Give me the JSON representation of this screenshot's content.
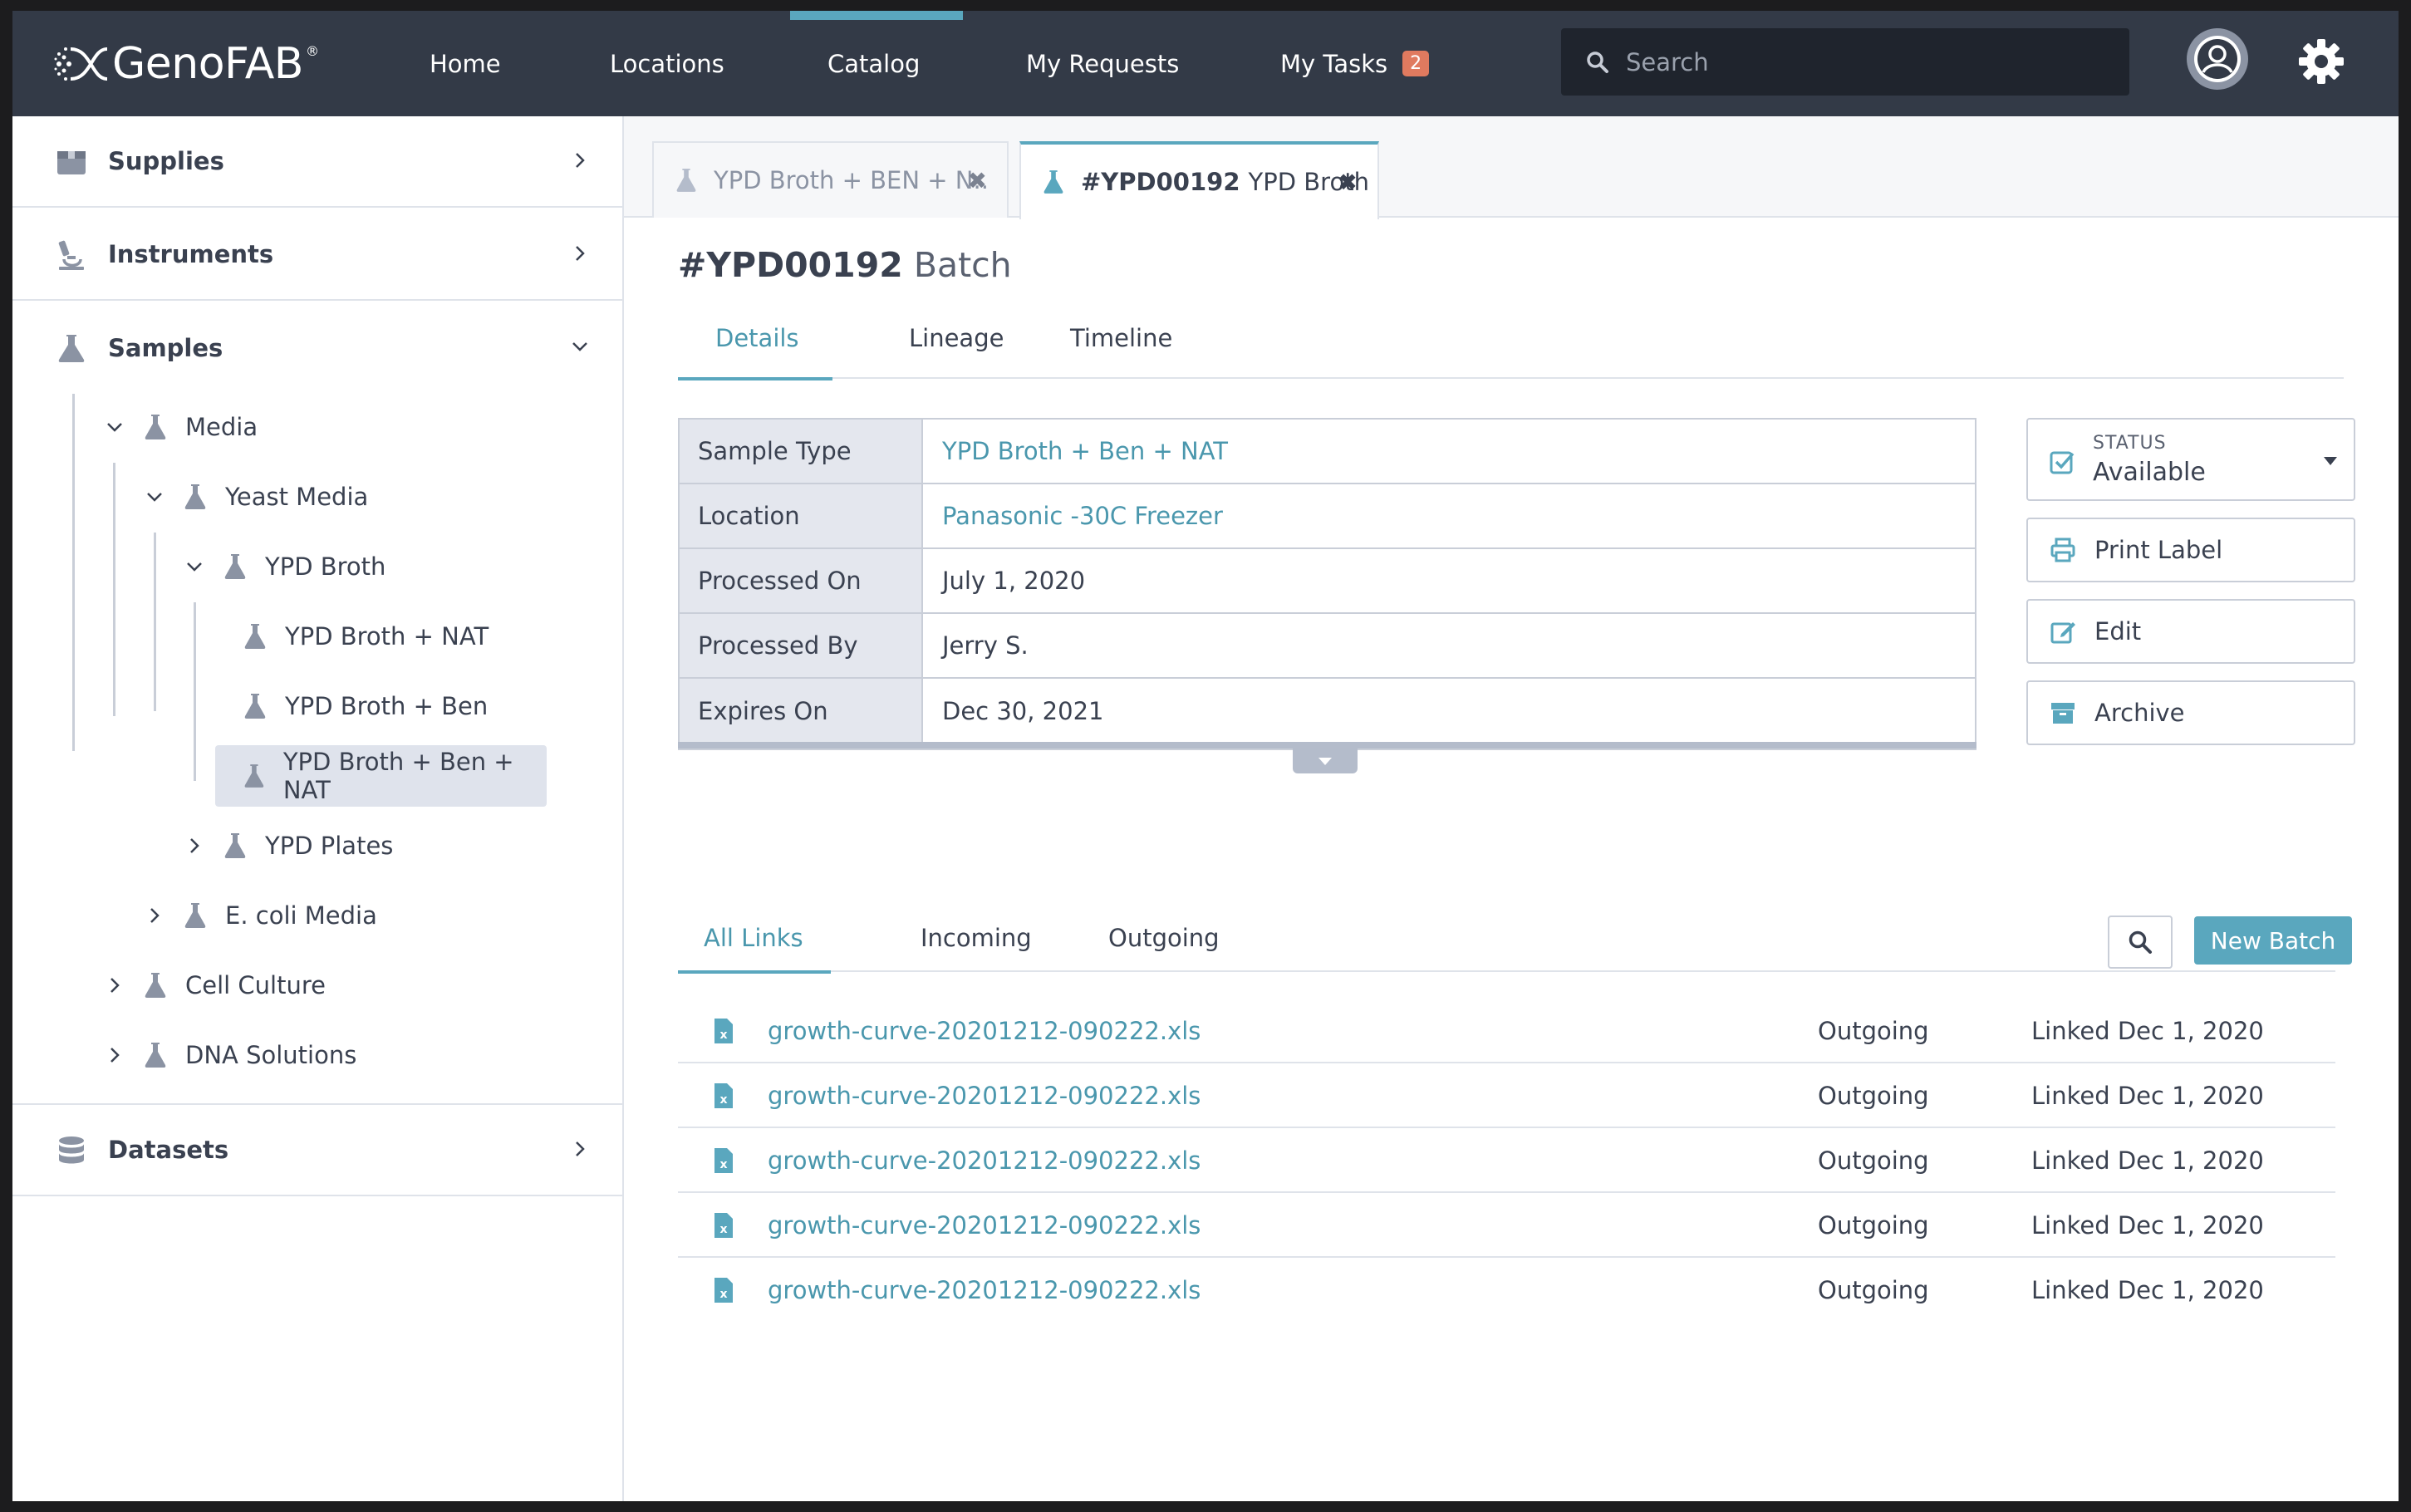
{
  "app": {
    "logo_text": "GenoFAB",
    "logo_mark": "®"
  },
  "nav": {
    "items": [
      {
        "label": "Home"
      },
      {
        "label": "Locations"
      },
      {
        "label": "Catalog",
        "active": true
      },
      {
        "label": "My Requests"
      },
      {
        "label": "My Tasks",
        "badge": "2"
      }
    ],
    "search_placeholder": "Search"
  },
  "sidebar": {
    "sections": [
      {
        "label": "Supplies",
        "icon": "box-icon",
        "expanded": false
      },
      {
        "label": "Instruments",
        "icon": "microscope-icon",
        "expanded": false
      },
      {
        "label": "Samples",
        "icon": "flask-icon",
        "expanded": true
      },
      {
        "label": "Datasets",
        "icon": "database-icon",
        "expanded": false
      }
    ],
    "tree": [
      {
        "label": "Media",
        "expanded": true
      },
      {
        "label": "Yeast Media",
        "expanded": true
      },
      {
        "label": "YPD Broth",
        "expanded": true
      },
      {
        "label": "YPD Broth + NAT"
      },
      {
        "label": "YPD Broth + Ben"
      },
      {
        "label": "YPD Broth + Ben + NAT",
        "selected": true
      },
      {
        "label": "YPD Plates",
        "expanded": false
      },
      {
        "label": "E. coli Media",
        "expanded": false
      },
      {
        "label": "Cell Culture",
        "expanded": false
      },
      {
        "label": "DNA Solutions",
        "expanded": false
      }
    ]
  },
  "doc_tabs": [
    {
      "label": "YPD Broth + BEN + N..",
      "active": false
    },
    {
      "label_strong": "#YPD00192",
      "label": "YPD Broth",
      "active": true
    }
  ],
  "page": {
    "id": "#YPD00192",
    "kind": "Batch",
    "tabs": [
      "Details",
      "Lineage",
      "Timeline"
    ],
    "active_tab": "Details"
  },
  "details": [
    {
      "key": "Sample Type",
      "value": "YPD Broth + Ben + NAT",
      "link": true
    },
    {
      "key": "Location",
      "value": "Panasonic -30C Freezer",
      "link": true
    },
    {
      "key": "Processed On",
      "value": "July 1, 2020"
    },
    {
      "key": "Processed By",
      "value": "Jerry S."
    },
    {
      "key": "Expires On",
      "value": "Dec 30, 2021"
    }
  ],
  "status": {
    "label": "STATUS",
    "value": "Available"
  },
  "actions": {
    "print_label": "Print Label",
    "edit": "Edit",
    "archive": "Archive"
  },
  "links": {
    "tabs": [
      "All Links",
      "Incoming",
      "Outgoing"
    ],
    "active_tab": "All Links",
    "new_batch_label": "New Batch",
    "rows": [
      {
        "file": "growth-curve-20201212-090222.xls",
        "direction": "Outgoing",
        "linked": "Linked Dec 1, 2020"
      },
      {
        "file": "growth-curve-20201212-090222.xls",
        "direction": "Outgoing",
        "linked": "Linked Dec 1, 2020"
      },
      {
        "file": "growth-curve-20201212-090222.xls",
        "direction": "Outgoing",
        "linked": "Linked Dec 1, 2020"
      },
      {
        "file": "growth-curve-20201212-090222.xls",
        "direction": "Outgoing",
        "linked": "Linked Dec 1, 2020"
      },
      {
        "file": "growth-curve-20201212-090222.xls",
        "direction": "Outgoing",
        "linked": "Linked Dec 1, 2020"
      }
    ]
  },
  "colors": {
    "topbar": "#333a47",
    "accent": "#5aa7be",
    "link": "#4a97ad",
    "badge": "#e07a5f",
    "icon_gray": "#8b93a3"
  }
}
